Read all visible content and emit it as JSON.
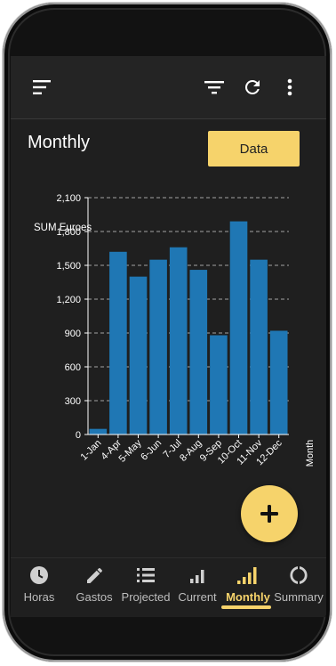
{
  "header": {
    "menu_icon": "sort-icon",
    "filter_icon": "filter-icon",
    "refresh_icon": "refresh-icon",
    "more_icon": "more-vert-icon"
  },
  "page": {
    "title": "Monthly",
    "data_button": "Data"
  },
  "fab": {
    "icon": "plus-icon"
  },
  "colors": {
    "accent": "#f6d36b",
    "bar": "#1f77b4",
    "background": "#242424"
  },
  "chart_data": {
    "type": "bar",
    "title": "",
    "ylabel": "SUM Euroes",
    "xlabel": "Month",
    "categories": [
      "1-Jan",
      "4-Apr",
      "5-May",
      "6-Jun",
      "7-Jul",
      "8-Aug",
      "9-Sep",
      "10-Oct",
      "11-Nov",
      "12-Dec"
    ],
    "values": [
      50,
      1620,
      1400,
      1550,
      1660,
      1460,
      880,
      1890,
      1550,
      920
    ],
    "ylim": [
      0,
      2100
    ],
    "yticks": [
      "0",
      "300",
      "600",
      "900",
      "1,200",
      "1,500",
      "1,800",
      "2,100"
    ],
    "ytick_values": [
      0,
      300,
      600,
      900,
      1200,
      1500,
      1800,
      2100
    ],
    "grid": true
  },
  "nav": {
    "items": [
      {
        "label": "Horas",
        "icon": "clock-icon",
        "active": false
      },
      {
        "label": "Gastos",
        "icon": "pencil-icon",
        "active": false
      },
      {
        "label": "Projected",
        "icon": "list-icon",
        "active": false
      },
      {
        "label": "Current",
        "icon": "signal-small-icon",
        "active": false
      },
      {
        "label": "Monthly",
        "icon": "signal-full-icon",
        "active": true
      },
      {
        "label": "Summary",
        "icon": "donut-icon",
        "active": false
      }
    ]
  }
}
